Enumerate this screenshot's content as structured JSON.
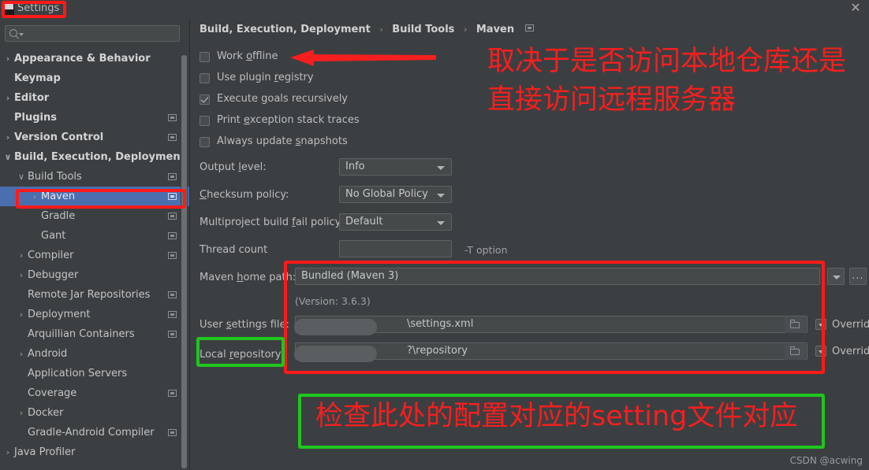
{
  "window": {
    "title": "Settings",
    "close_label": "✕",
    "app_icon": "intellij-idea-icon"
  },
  "search": {
    "placeholder": "",
    "value": "",
    "icon": "search-icon"
  },
  "sidebar": {
    "items": [
      {
        "label": "Appearance & Behavior",
        "indent": 18,
        "arrow": "›",
        "bold": true,
        "modified": false,
        "selected": false
      },
      {
        "label": "Keymap",
        "indent": 18,
        "arrow": "",
        "bold": true,
        "modified": false,
        "selected": false
      },
      {
        "label": "Editor",
        "indent": 18,
        "arrow": "›",
        "bold": true,
        "modified": false,
        "selected": false
      },
      {
        "label": "Plugins",
        "indent": 18,
        "arrow": "",
        "bold": true,
        "modified": true,
        "selected": false
      },
      {
        "label": "Version Control",
        "indent": 18,
        "arrow": "›",
        "bold": true,
        "modified": true,
        "selected": false
      },
      {
        "label": "Build, Execution, Deployment",
        "indent": 18,
        "arrow": "∨",
        "bold": true,
        "modified": false,
        "selected": false
      },
      {
        "label": "Build Tools",
        "indent": 35,
        "arrow": "∨",
        "bold": false,
        "modified": true,
        "selected": false
      },
      {
        "label": "Maven",
        "indent": 52,
        "arrow": "›",
        "bold": false,
        "modified": true,
        "selected": true
      },
      {
        "label": "Gradle",
        "indent": 52,
        "arrow": "",
        "bold": false,
        "modified": true,
        "selected": false
      },
      {
        "label": "Gant",
        "indent": 52,
        "arrow": "",
        "bold": false,
        "modified": true,
        "selected": false
      },
      {
        "label": "Compiler",
        "indent": 35,
        "arrow": "›",
        "bold": false,
        "modified": true,
        "selected": false
      },
      {
        "label": "Debugger",
        "indent": 35,
        "arrow": "›",
        "bold": false,
        "modified": false,
        "selected": false
      },
      {
        "label": "Remote Jar Repositories",
        "indent": 35,
        "arrow": "",
        "bold": false,
        "modified": true,
        "selected": false
      },
      {
        "label": "Deployment",
        "indent": 35,
        "arrow": "›",
        "bold": false,
        "modified": true,
        "selected": false
      },
      {
        "label": "Arquillian Containers",
        "indent": 35,
        "arrow": "",
        "bold": false,
        "modified": true,
        "selected": false
      },
      {
        "label": "Android",
        "indent": 35,
        "arrow": "›",
        "bold": false,
        "modified": false,
        "selected": false
      },
      {
        "label": "Application Servers",
        "indent": 35,
        "arrow": "",
        "bold": false,
        "modified": false,
        "selected": false
      },
      {
        "label": "Coverage",
        "indent": 35,
        "arrow": "",
        "bold": false,
        "modified": true,
        "selected": false
      },
      {
        "label": "Docker",
        "indent": 35,
        "arrow": "›",
        "bold": false,
        "modified": false,
        "selected": false
      },
      {
        "label": "Gradle-Android Compiler",
        "indent": 35,
        "arrow": "",
        "bold": false,
        "modified": true,
        "selected": false
      },
      {
        "label": "Java Profiler",
        "indent": 18,
        "arrow": "›",
        "bold": false,
        "modified": false,
        "selected": false
      }
    ]
  },
  "breadcrumb": {
    "part1": "Build, Execution, Deployment",
    "sep": "›",
    "part2": "Build Tools",
    "part3": "Maven"
  },
  "checkboxes": [
    {
      "label_pre": "Work ",
      "label_key": "o",
      "label_post": "ffline",
      "checked": false
    },
    {
      "label_pre": "Use plugin ",
      "label_key": "r",
      "label_post": "egistry",
      "checked": false
    },
    {
      "label_pre": "Execute ",
      "label_key": "g",
      "label_post": "oals recursively",
      "checked": true
    },
    {
      "label_pre": "Print ",
      "label_key": "e",
      "label_post": "xception stack traces",
      "checked": false
    },
    {
      "label_pre": "Always update ",
      "label_key": "s",
      "label_post": "napshots",
      "checked": false
    }
  ],
  "fields": {
    "output_level": {
      "label_pre": "Output ",
      "label_key": "l",
      "label_post": "evel:",
      "value": "Info"
    },
    "checksum": {
      "label_pre": "",
      "label_key": "C",
      "label_post": "hecksum policy:",
      "value": "No Global Policy"
    },
    "multiproject": {
      "label_pre": "Multiproject build ",
      "label_key": "f",
      "label_post": "ail policy:",
      "value": "Default"
    },
    "thread_count": {
      "label_pre": "Thread count",
      "label_key": "",
      "label_post": "",
      "value": "",
      "hint": "-T option"
    },
    "maven_home": {
      "label_pre": "Maven ",
      "label_key": "h",
      "label_post": "ome path:",
      "value": "Bundled (Maven 3)",
      "version_note": "(Version: 3.6.3)",
      "ellipsis": "..."
    },
    "user_settings": {
      "label_pre": "User ",
      "label_key": "s",
      "label_post": "ettings file:",
      "value": "\\settings.xml",
      "override": "Override"
    },
    "local_repo": {
      "label_pre": "Local ",
      "label_key": "r",
      "label_post": "epository:",
      "value": "?\\repository",
      "override": "Override"
    }
  },
  "annotations": {
    "note_top": "取决于是否访问本地仓库还是是\n直接访问远程服务器",
    "note_top_line1": "取决于是否访问本地仓库还是",
    "note_top_line2": "直接访问远程服务器",
    "note_bottom": "检查此处的配置对应的setting文件对应",
    "colors": {
      "red": "#ff1a1a",
      "green": "#1fc61f",
      "text_red": "#f51f1f"
    }
  },
  "watermark": {
    "text": "CSDN @acwing"
  }
}
